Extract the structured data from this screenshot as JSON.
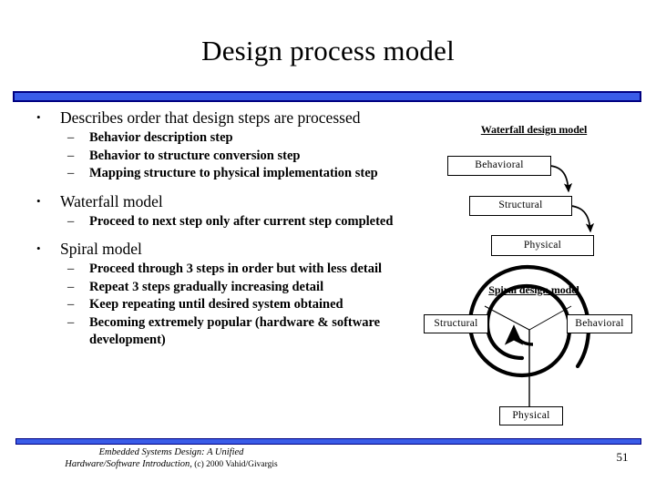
{
  "slide": {
    "title": "Design process model",
    "page_number": "51",
    "accent_color": "#3a5ce8",
    "accent_border_color": "#000080"
  },
  "body": {
    "bullets": [
      {
        "marker": "•",
        "text": "Describes order that design steps are processed",
        "sub": [
          {
            "marker": "–",
            "text": "Behavior description step"
          },
          {
            "marker": "–",
            "text": "Behavior to structure conversion step"
          },
          {
            "marker": "–",
            "text": "Mapping structure to physical implementation step"
          }
        ]
      },
      {
        "marker": "•",
        "text": "Waterfall model",
        "sub": [
          {
            "marker": "–",
            "text": "Proceed to next step only after current step completed"
          }
        ]
      },
      {
        "marker": "•",
        "text": "Spiral model",
        "sub": [
          {
            "marker": "–",
            "text": "Proceed through 3 steps in order but with less detail"
          },
          {
            "marker": "–",
            "text": "Repeat 3 steps gradually increasing detail"
          },
          {
            "marker": "–",
            "text": "Keep repeating until desired system obtained"
          },
          {
            "marker": "–",
            "text": "Becoming extremely popular (hardware & software development)"
          }
        ]
      }
    ]
  },
  "diagrams": {
    "waterfall": {
      "heading": "Waterfall design model",
      "boxes": [
        {
          "label": "Behavioral"
        },
        {
          "label": "Structural"
        },
        {
          "label": "Physical"
        }
      ]
    },
    "spiral": {
      "heading": "Spiral design model",
      "boxes": [
        {
          "label": "Structural"
        },
        {
          "label": "Behavioral"
        },
        {
          "label": "Physical"
        }
      ]
    }
  },
  "footer": {
    "line1": "Embedded Systems Design: A Unified",
    "line2": "Hardware/Software Introduction,",
    "line2_plain": " (c) 2000 Vahid/Givargis"
  }
}
